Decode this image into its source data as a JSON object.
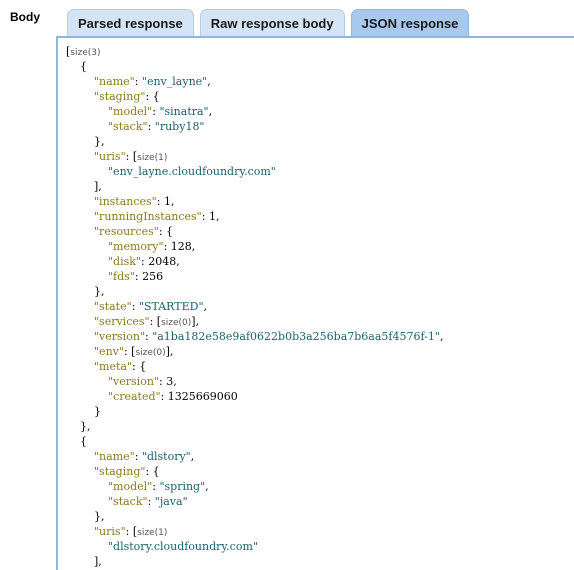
{
  "section_label": "Body",
  "tabs": [
    {
      "label": "Parsed response",
      "active": false
    },
    {
      "label": "Raw response body",
      "active": false
    },
    {
      "label": "JSON response",
      "active": true
    }
  ],
  "json_lines": [
    [
      0,
      [
        [
          "p",
          "["
        ],
        [
          "m",
          "size(3)"
        ]
      ]
    ],
    [
      1,
      [
        [
          "p",
          "{"
        ]
      ]
    ],
    [
      2,
      [
        [
          "k",
          "\"name\""
        ],
        [
          "p",
          ": "
        ],
        [
          "s",
          "\"env_layne\""
        ],
        [
          "p",
          ","
        ]
      ]
    ],
    [
      2,
      [
        [
          "k",
          "\"staging\""
        ],
        [
          "p",
          ": {"
        ]
      ]
    ],
    [
      3,
      [
        [
          "k",
          "\"model\""
        ],
        [
          "p",
          ": "
        ],
        [
          "s",
          "\"sinatra\""
        ],
        [
          "p",
          ","
        ]
      ]
    ],
    [
      3,
      [
        [
          "k",
          "\"stack\""
        ],
        [
          "p",
          ": "
        ],
        [
          "s",
          "\"ruby18\""
        ]
      ]
    ],
    [
      2,
      [
        [
          "p",
          "},"
        ]
      ]
    ],
    [
      2,
      [
        [
          "k",
          "\"uris\""
        ],
        [
          "p",
          ": ["
        ],
        [
          "m",
          "size(1)"
        ]
      ]
    ],
    [
      3,
      [
        [
          "s",
          "\"env_layne.cloudfoundry.com\""
        ]
      ]
    ],
    [
      2,
      [
        [
          "p",
          "],"
        ]
      ]
    ],
    [
      2,
      [
        [
          "k",
          "\"instances\""
        ],
        [
          "p",
          ": "
        ],
        [
          "n",
          "1"
        ],
        [
          "p",
          ","
        ]
      ]
    ],
    [
      2,
      [
        [
          "k",
          "\"runningInstances\""
        ],
        [
          "p",
          ": "
        ],
        [
          "n",
          "1"
        ],
        [
          "p",
          ","
        ]
      ]
    ],
    [
      2,
      [
        [
          "k",
          "\"resources\""
        ],
        [
          "p",
          ": {"
        ]
      ]
    ],
    [
      3,
      [
        [
          "k",
          "\"memory\""
        ],
        [
          "p",
          ": "
        ],
        [
          "n",
          "128"
        ],
        [
          "p",
          ","
        ]
      ]
    ],
    [
      3,
      [
        [
          "k",
          "\"disk\""
        ],
        [
          "p",
          ": "
        ],
        [
          "n",
          "2048"
        ],
        [
          "p",
          ","
        ]
      ]
    ],
    [
      3,
      [
        [
          "k",
          "\"fds\""
        ],
        [
          "p",
          ": "
        ],
        [
          "n",
          "256"
        ]
      ]
    ],
    [
      2,
      [
        [
          "p",
          "},"
        ]
      ]
    ],
    [
      2,
      [
        [
          "k",
          "\"state\""
        ],
        [
          "p",
          ": "
        ],
        [
          "s",
          "\"STARTED\""
        ],
        [
          "p",
          ","
        ]
      ]
    ],
    [
      2,
      [
        [
          "k",
          "\"services\""
        ],
        [
          "p",
          ": ["
        ],
        [
          "m",
          "size(0)"
        ],
        [
          "p",
          "],"
        ]
      ]
    ],
    [
      2,
      [
        [
          "k",
          "\"version\""
        ],
        [
          "p",
          ": "
        ],
        [
          "s",
          "\"a1ba182e58e9af0622b0b3a256ba7b6aa5f4576f-1\""
        ],
        [
          "p",
          ","
        ]
      ]
    ],
    [
      2,
      [
        [
          "k",
          "\"env\""
        ],
        [
          "p",
          ": ["
        ],
        [
          "m",
          "size(0)"
        ],
        [
          "p",
          "],"
        ]
      ]
    ],
    [
      2,
      [
        [
          "k",
          "\"meta\""
        ],
        [
          "p",
          ": {"
        ]
      ]
    ],
    [
      3,
      [
        [
          "k",
          "\"version\""
        ],
        [
          "p",
          ": "
        ],
        [
          "n",
          "3"
        ],
        [
          "p",
          ","
        ]
      ]
    ],
    [
      3,
      [
        [
          "k",
          "\"created\""
        ],
        [
          "p",
          ": "
        ],
        [
          "n",
          "1325669060"
        ]
      ]
    ],
    [
      2,
      [
        [
          "p",
          "}"
        ]
      ]
    ],
    [
      1,
      [
        [
          "p",
          "},"
        ]
      ]
    ],
    [
      1,
      [
        [
          "p",
          "{"
        ]
      ]
    ],
    [
      2,
      [
        [
          "k",
          "\"name\""
        ],
        [
          "p",
          ": "
        ],
        [
          "s",
          "\"dlstory\""
        ],
        [
          "p",
          ","
        ]
      ]
    ],
    [
      2,
      [
        [
          "k",
          "\"staging\""
        ],
        [
          "p",
          ": {"
        ]
      ]
    ],
    [
      3,
      [
        [
          "k",
          "\"model\""
        ],
        [
          "p",
          ": "
        ],
        [
          "s",
          "\"spring\""
        ],
        [
          "p",
          ","
        ]
      ]
    ],
    [
      3,
      [
        [
          "k",
          "\"stack\""
        ],
        [
          "p",
          ": "
        ],
        [
          "s",
          "\"java\""
        ]
      ]
    ],
    [
      2,
      [
        [
          "p",
          "},"
        ]
      ]
    ],
    [
      2,
      [
        [
          "k",
          "\"uris\""
        ],
        [
          "p",
          ": ["
        ],
        [
          "m",
          "size(1)"
        ]
      ]
    ],
    [
      3,
      [
        [
          "s",
          "\"dlstory.cloudfoundry.com\""
        ]
      ]
    ],
    [
      2,
      [
        [
          "p",
          "],"
        ]
      ]
    ]
  ]
}
